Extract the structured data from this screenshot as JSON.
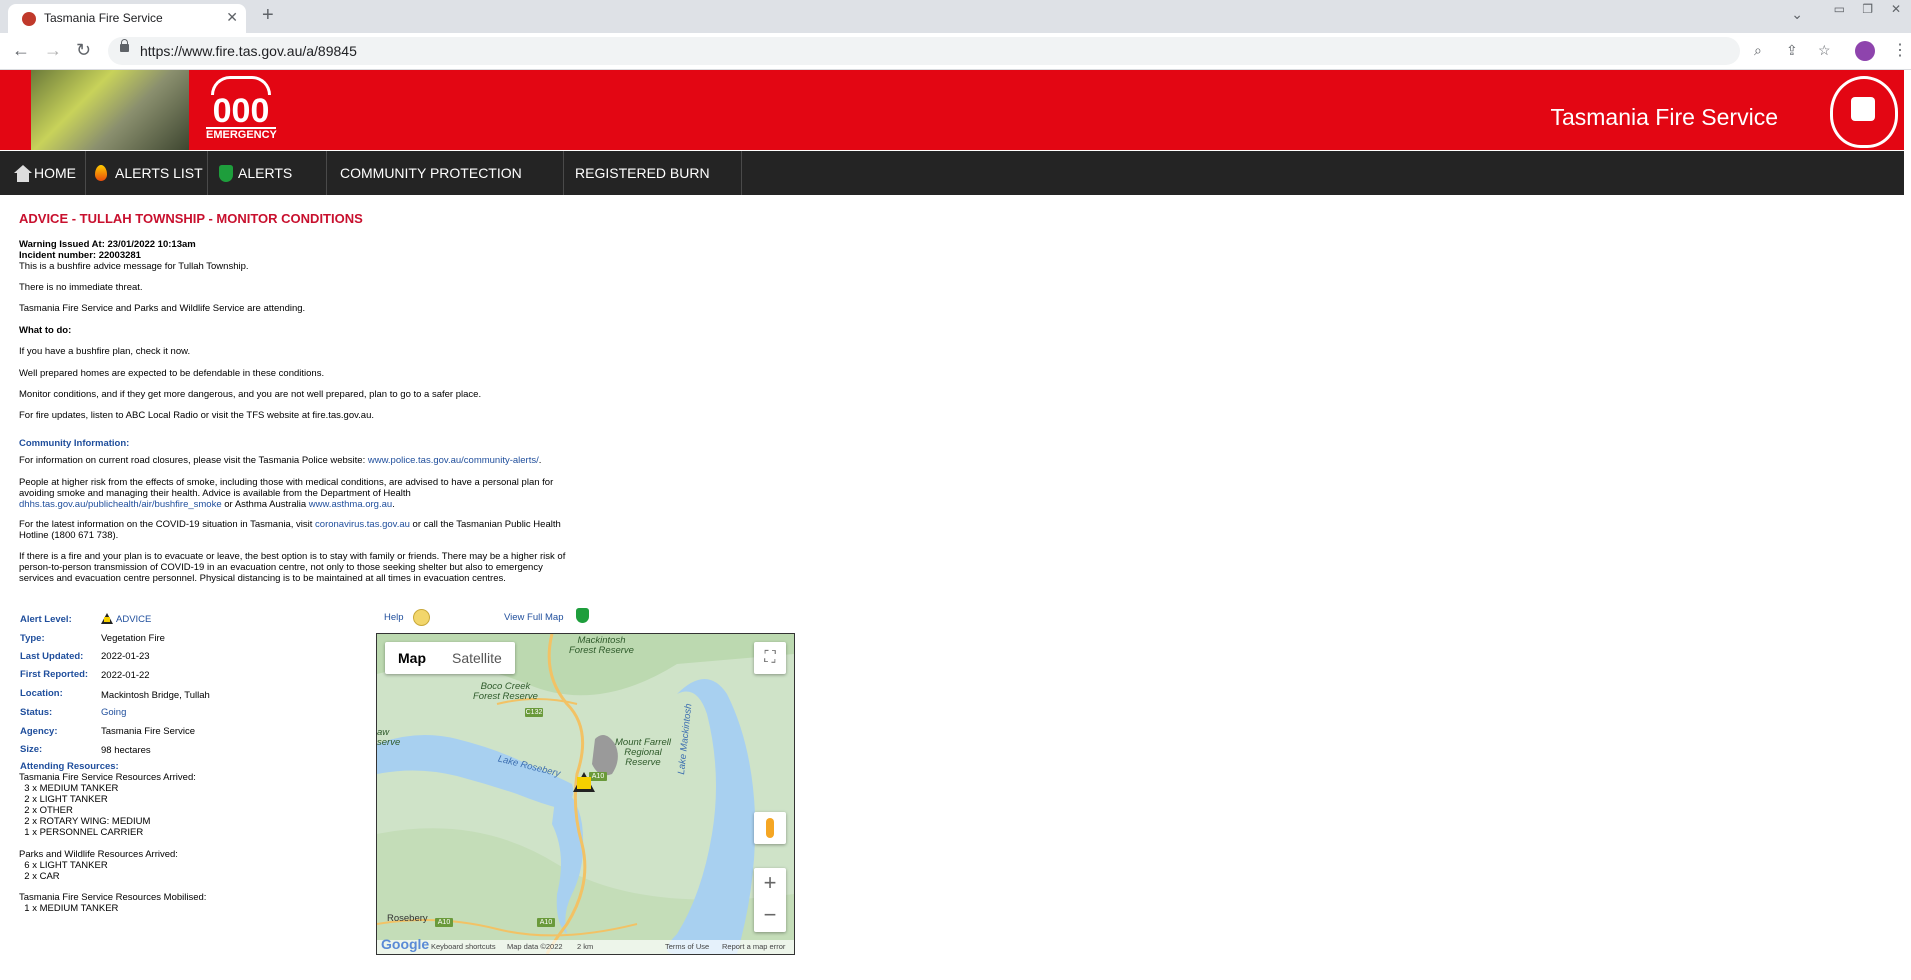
{
  "browser": {
    "tab_title": "Tasmania Fire Service",
    "url": "https://www.fire.tas.gov.au/a/89845",
    "new_tab_glyph": "+",
    "close_glyph": "✕"
  },
  "header": {
    "emergency_number": "000",
    "emergency_word": "EMERGENCY",
    "brand": "Tasmania Fire Service"
  },
  "nav": {
    "items": [
      {
        "label": "HOME",
        "icon": "home-icon"
      },
      {
        "label": "ALERTS LIST",
        "icon": "flame-icon"
      },
      {
        "label": "ALERTS MAP",
        "icon": "tasmania-icon"
      },
      {
        "label": "COMMUNITY PROTECTION PLANS"
      },
      {
        "label": "REGISTERED BURN LIST"
      }
    ]
  },
  "alert": {
    "title": "ADVICE - TULLAH TOWNSHIP - MONITOR CONDITIONS",
    "issued": "Warning Issued At: 23/01/2022 10:13am",
    "incident": "Incident number: 22003281",
    "intro": "This is a bushfire advice message for Tullah Township.",
    "threat": "There is no immediate threat.",
    "attending": "Tasmania Fire Service and Parks and Wildlife Service are attending.",
    "what_to_do_heading": "What to do:",
    "todo": [
      "If you have a bushfire plan, check it now.",
      "Well prepared homes are expected to be defendable in these conditions.",
      "Monitor conditions, and if they get more dangerous, and you are not well prepared, plan to go to a safer place.",
      "For fire updates, listen to ABC Local Radio or visit the TFS website at fire.tas.gov.au."
    ],
    "community_heading": "Community Information:",
    "road_text": "For information on current road closures, please visit the Tasmania Police website: ",
    "road_link": "www.police.tas.gov.au/community-alerts/",
    "road_end": ".",
    "smoke_text_1": "People at higher risk from the effects of smoke, including those with medical conditions, are advised to have a personal plan for",
    "smoke_text_2": "avoiding smoke and managing their health. Advice is available from the Department of Health",
    "smoke_link_1": "dhhs.tas.gov.au/publichealth/air/bushfire_smoke",
    "smoke_mid": " or Asthma Australia ",
    "smoke_link_2": "www.asthma.org.au",
    "smoke_end": ".",
    "covid_text_1": "For the latest information on the COVID-19 situation in Tasmania, visit ",
    "covid_link": "coronavirus.tas.gov.au",
    "covid_text_2": " or call the Tasmanian Public Health",
    "covid_text_3": "Hotline (1800 671 738).",
    "evac_1": "If there is a fire and your plan is to evacuate or leave, the best option is to stay with family or friends. There may be a higher risk of",
    "evac_2": "person-to-person transmission of COVID-19 in an evacuation centre, not only to those seeking shelter but also to emergency",
    "evac_3": "services and evacuation centre personnel. Physical distancing is to be maintained at all times in evacuation centres."
  },
  "details": {
    "alert_level_label": "Alert Level:",
    "alert_level_value": "ADVICE",
    "type_label": "Type:",
    "type_value": "Vegetation Fire",
    "last_updated_label": "Last Updated:",
    "last_updated_value": "2022-01-23",
    "first_reported_label": "First Reported:",
    "first_reported_value": "2022-01-22",
    "location_label": "Location:",
    "location_value": "Mackintosh Bridge, Tullah",
    "status_label": "Status:",
    "status_value": "Going",
    "agency_label": "Agency:",
    "agency_value": "Tasmania Fire Service",
    "size_label": "Size:",
    "size_value": "98 hectares",
    "resources_label": "Attending Resources:"
  },
  "resources": {
    "tfs_arrived_heading": "Tasmania Fire Service Resources Arrived:",
    "tfs_arrived": [
      "  3 x MEDIUM TANKER",
      "  2 x LIGHT TANKER",
      "  2 x OTHER",
      "  2 x ROTARY WING: MEDIUM",
      "  1 x PERSONNEL CARRIER"
    ],
    "pws_arrived_heading": "Parks and Wildlife Resources Arrived:",
    "pws_arrived": [
      "  6 x LIGHT TANKER",
      "  2 x CAR"
    ],
    "tfs_mobilised_heading": "Tasmania Fire Service Resources Mobilised:",
    "tfs_mobilised": [
      "  1 x MEDIUM TANKER"
    ]
  },
  "map": {
    "help_label": "Help",
    "full_map_label": "View Full Map",
    "map_btn": "Map",
    "satellite_btn": "Satellite",
    "fullscreen_glyph": "⛶",
    "zoom_in": "+",
    "zoom_out": "−",
    "labels": {
      "mackintosh": "Mackintosh\nForest Reserve",
      "boco": "Boco Creek\nForest Reserve",
      "farrell": "Mount Farrell\nRegional\nReserve",
      "lake_rosebery": "Lake Rosebery",
      "lake_mackintosh": "Lake Mackintosh",
      "rosebery": "Rosebery",
      "reserve_left": "aw\nserve",
      "a10": "A10",
      "c132": "C132"
    },
    "footer": {
      "shortcuts": "Keyboard shortcuts",
      "data": "Map data ©2022",
      "scale": "2 km",
      "terms": "Terms of Use",
      "report": "Report a map error"
    },
    "google": "Google"
  }
}
